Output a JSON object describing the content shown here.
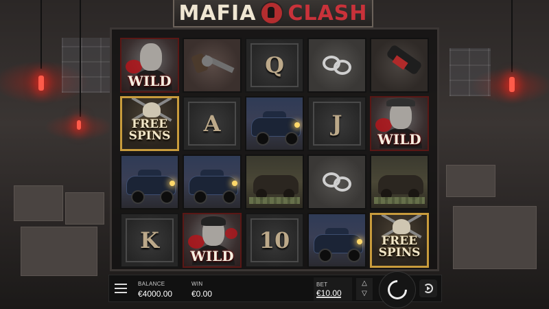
{
  "game": {
    "logo_left": "MAFIA",
    "logo_right": "CLASH"
  },
  "colors": {
    "accent_red": "#c9323a",
    "gold_frame": "#c99c3c"
  },
  "reels": [
    [
      {
        "symbol": "wild",
        "label": "WILD",
        "variant": "mobster-bald"
      },
      {
        "symbol": "free_spins",
        "label": "FREE SPINS"
      },
      {
        "symbol": "car",
        "label": ""
      },
      {
        "symbol": "letter",
        "label": "K"
      }
    ],
    [
      {
        "symbol": "revolver",
        "label": ""
      },
      {
        "symbol": "letter",
        "label": "A"
      },
      {
        "symbol": "car",
        "label": ""
      },
      {
        "symbol": "wild",
        "label": "WILD",
        "variant": "mobster-slick"
      }
    ],
    [
      {
        "symbol": "letter",
        "label": "Q"
      },
      {
        "symbol": "car",
        "label": ""
      },
      {
        "symbol": "wrecked_car_cash",
        "label": ""
      },
      {
        "symbol": "letter",
        "label": "10"
      }
    ],
    [
      {
        "symbol": "handcuffs",
        "label": ""
      },
      {
        "symbol": "letter",
        "label": "J"
      },
      {
        "symbol": "handcuffs",
        "label": ""
      },
      {
        "symbol": "car",
        "label": ""
      }
    ],
    [
      {
        "symbol": "whiskey_bottle",
        "label": ""
      },
      {
        "symbol": "wild",
        "label": "WILD",
        "variant": "mobster-cap"
      },
      {
        "symbol": "wrecked_car_cash",
        "label": ""
      },
      {
        "symbol": "free_spins",
        "label": "FREE SPINS"
      }
    ]
  ],
  "labels": {
    "wild": "WILD",
    "free_line1": "FREE",
    "free_line2": "SPINS",
    "K": "K",
    "A": "A",
    "Q": "Q",
    "J": "J",
    "ten": "10"
  },
  "controls": {
    "menu_icon": "hamburger-menu-icon",
    "balance_label": "BALANCE",
    "balance_value": "€4000.00",
    "win_label": "WIN",
    "win_value": "€0.00",
    "bet_label": "BET",
    "bet_value": "€10.00",
    "spin_icon": "spin-icon",
    "autoplay_icon": "autoplay-icon"
  }
}
